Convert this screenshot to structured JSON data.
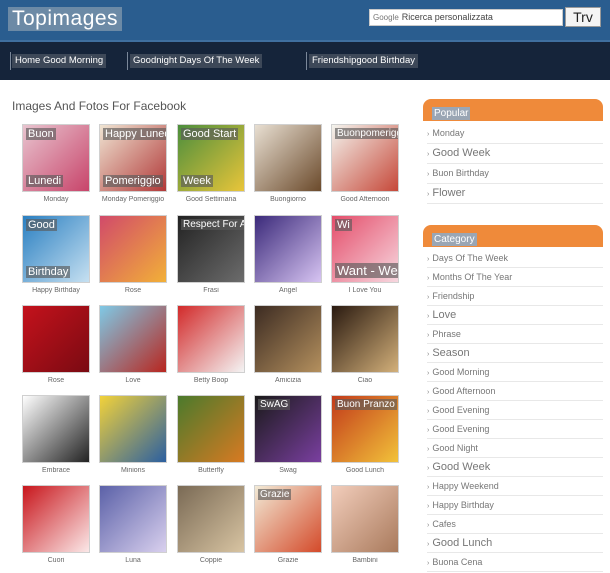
{
  "header": {
    "logo": "Topimages",
    "search_brand": "Google",
    "search_placeholder": "Ricerca personalizzata",
    "search_button": "Trv"
  },
  "nav": {
    "items": [
      "Home Good Morning",
      "Goodnight Days Of The Week",
      "Friendshipgood Birthday"
    ]
  },
  "main": {
    "title": "Images And Fotos For Facebook"
  },
  "grid": {
    "rows": [
      [
        {
          "caption": "Monday",
          "overlay": "Buon\nLunedi",
          "colors": [
            "#e8c4cf",
            "#c8446a"
          ]
        },
        {
          "caption": "Monday Pomeriggio",
          "overlay": "Happy Luned\nPomeriggio",
          "colors": [
            "#efe4d2",
            "#b13838"
          ]
        },
        {
          "caption": "Good Settimana",
          "overlay": "Good Start\nWeek",
          "colors": [
            "#4c8e3c",
            "#e9c53a"
          ]
        },
        {
          "caption": "Buongiorno",
          "overlay": "",
          "colors": [
            "#e8dfd2",
            "#6b4a2b"
          ]
        },
        {
          "caption": "Good Afternoon",
          "overlay": "Buonpomeriggio",
          "colors": [
            "#f4f4ee",
            "#c64839"
          ]
        }
      ],
      [
        {
          "caption": "Happy Birthday",
          "overlay": "Good\nBirthday",
          "colors": [
            "#2a7fc1",
            "#c6e0f1"
          ]
        },
        {
          "caption": "Rose",
          "overlay": "",
          "colors": [
            "#d14a6a",
            "#f2b038"
          ]
        },
        {
          "caption": "Frasi",
          "overlay": "Respect For All",
          "colors": [
            "#222222",
            "#6c6c6c"
          ]
        },
        {
          "caption": "Angel",
          "overlay": "",
          "colors": [
            "#3b2a7a",
            "#d7c4f2"
          ]
        },
        {
          "caption": "I Love You",
          "overlay": "Wi\nWant\n- Well",
          "colors": [
            "#e44d6a",
            "#f7d7df"
          ]
        }
      ],
      [
        {
          "caption": "Rose",
          "overlay": "",
          "colors": [
            "#c4121c",
            "#7a0a12"
          ]
        },
        {
          "caption": "Love",
          "overlay": "",
          "colors": [
            "#7fc9e6",
            "#b8261f"
          ]
        },
        {
          "caption": "Betty Boop",
          "overlay": "",
          "colors": [
            "#d22a2a",
            "#f4f4f4"
          ]
        },
        {
          "caption": "Amicizia",
          "overlay": "",
          "colors": [
            "#3c2b22",
            "#b4905e"
          ]
        },
        {
          "caption": "Ciao",
          "overlay": "",
          "colors": [
            "#2a1a10",
            "#d3b07a"
          ]
        }
      ],
      [
        {
          "caption": "Embrace",
          "overlay": "",
          "colors": [
            "#ffffff",
            "#222222"
          ]
        },
        {
          "caption": "Minions",
          "overlay": "",
          "colors": [
            "#f2d23a",
            "#2b5fa0"
          ]
        },
        {
          "caption": "Butterfly",
          "overlay": "",
          "colors": [
            "#4b7a2c",
            "#d87a22"
          ]
        },
        {
          "caption": "Swag",
          "overlay": "SwAG",
          "colors": [
            "#1a1a1a",
            "#7a3fa0"
          ]
        },
        {
          "caption": "Good Lunch",
          "overlay": "Buon Pranzo",
          "colors": [
            "#c23a1a",
            "#f2c23a"
          ]
        }
      ],
      [
        {
          "caption": "Cuori",
          "overlay": "",
          "colors": [
            "#c8161c",
            "#fbe8e8"
          ]
        },
        {
          "caption": "Luna",
          "overlay": "",
          "colors": [
            "#5b61a8",
            "#d9d0ee"
          ]
        },
        {
          "caption": "Coppie",
          "overlay": "",
          "colors": [
            "#7a6a55",
            "#d8c4a2"
          ]
        },
        {
          "caption": "Grazie",
          "overlay": "Grazie",
          "colors": [
            "#f2ead6",
            "#d44a2a"
          ]
        },
        {
          "caption": "Bambini",
          "overlay": "",
          "colors": [
            "#f2cdbb",
            "#a97a5c"
          ]
        }
      ]
    ]
  },
  "sidebar": {
    "popular_title": "Popular",
    "popular_items": [
      "Monday",
      "Good Week",
      "Buon Birthday",
      "Flower"
    ],
    "category_title": "Category",
    "category_items": [
      "Days Of The Week",
      "Months Of The Year",
      "Friendship",
      "Love",
      "Phrase",
      "Season",
      "Good Morning",
      "Good Afternoon",
      "Good Evening",
      "Good Evening",
      "Good Night",
      "Good Week",
      "Happy Weekend",
      "Happy Birthday",
      "Cafes",
      "Good Lunch",
      "Buona Cena"
    ]
  },
  "colors": {
    "header_bg": "#2a5d8f",
    "nav_bg": "#15243a",
    "panel_accent": "#ef8a3a"
  }
}
